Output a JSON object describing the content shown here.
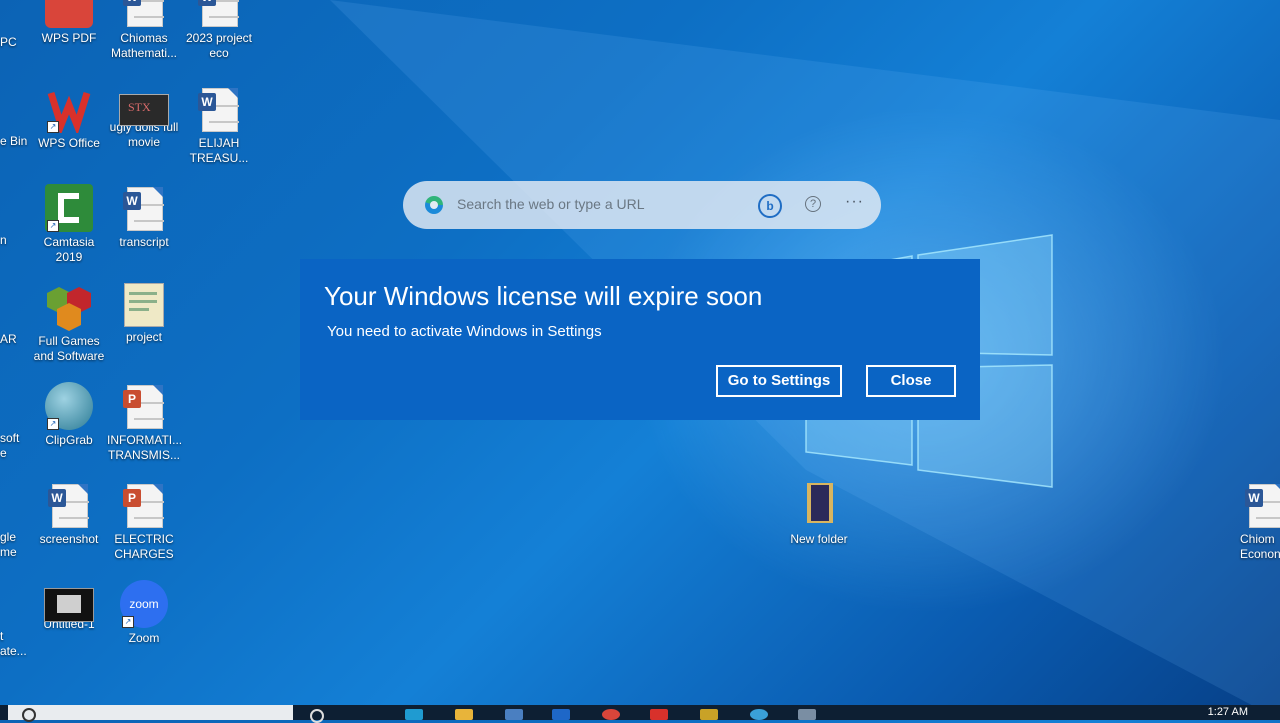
{
  "desktop": {
    "icons": [
      {
        "label": "WPS PDF"
      },
      {
        "label": "Chiomas Mathemati..."
      },
      {
        "label": "2023 project eco"
      },
      {
        "label": "WPS Office"
      },
      {
        "label": "ugly dolls full movie"
      },
      {
        "label": "ELIJAH TREASU..."
      },
      {
        "label": "Camtasia 2019"
      },
      {
        "label": "transcript"
      },
      {
        "label": "Full Games and Software"
      },
      {
        "label": "project"
      },
      {
        "label": "ClipGrab"
      },
      {
        "label": "INFORMATI... TRANSMIS..."
      },
      {
        "label": "screenshot"
      },
      {
        "label": "ELECTRIC CHARGES"
      },
      {
        "label": "Untitled-1"
      },
      {
        "label": "Zoom"
      },
      {
        "label": "New folder"
      },
      {
        "label": "Chiom Econon"
      }
    ],
    "cut_labels": [
      {
        "label": "PC"
      },
      {
        "label": "e Bin"
      },
      {
        "label": "n"
      },
      {
        "label": "AR"
      },
      {
        "label": "soft e"
      },
      {
        "label": "gle me"
      },
      {
        "label": "t ate..."
      }
    ]
  },
  "search_bar": {
    "placeholder": "Search the web or type a URL",
    "bing_glyph": "b",
    "help_glyph": "?",
    "more_glyph": "···"
  },
  "dialog": {
    "title": "Your Windows license will expire soon",
    "message": "You need to activate Windows in Settings",
    "primary_button": "Go to Settings",
    "secondary_button": "Close"
  },
  "taskbar": {
    "time": "1:27 AM"
  },
  "colors": {
    "dialog_bg": "#0a64c4",
    "desktop_accent": "#0d6fc4"
  }
}
